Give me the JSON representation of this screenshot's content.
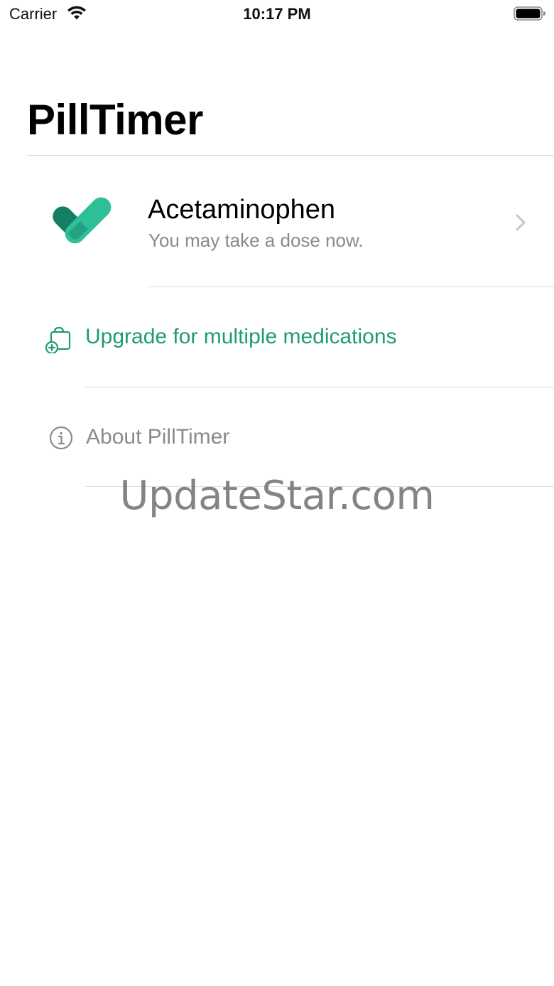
{
  "status_bar": {
    "carrier": "Carrier",
    "time": "10:17 PM"
  },
  "header": {
    "title": "PillTimer"
  },
  "medications": [
    {
      "name": "Acetaminophen",
      "status": "You may take a dose now.",
      "icon": "pill-check-icon"
    }
  ],
  "menu": {
    "upgrade_label": "Upgrade for multiple medications",
    "about_label": "About PillTimer"
  },
  "watermark": "UpdateStar.com",
  "colors": {
    "accent": "#1f9a78",
    "accent_light": "#2ebf99",
    "accent_dark": "#157f63",
    "secondary_text": "#8a8a8e",
    "divider": "#dcdcdc"
  }
}
